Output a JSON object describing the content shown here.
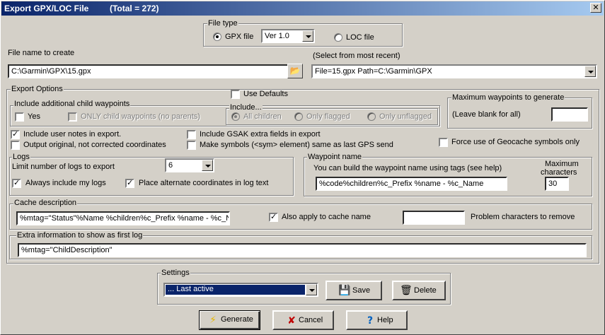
{
  "window": {
    "title": "Export GPX/LOC File",
    "total": "(Total = 272)",
    "close_glyph": "✕"
  },
  "file_type": {
    "label": "File type",
    "gpx_label": "GPX file",
    "gpx_selected": true,
    "version": "Ver 1.0",
    "loc_label": "LOC file",
    "loc_selected": false
  },
  "file_name": {
    "label": "File name to create",
    "value": "C:\\Garmin\\GPX\\15.gpx",
    "recent_label": "(Select from most recent)",
    "recent_value": "File=15.gpx Path=C:\\Garmin\\GPX"
  },
  "export_options": {
    "label": "Export Options",
    "use_defaults": "Use Defaults",
    "child_waypoints": {
      "label": "Include additional child waypoints",
      "yes": "Yes",
      "only_child": "ONLY child waypoints (no parents)",
      "include_label": "Include...",
      "all_children": "All children",
      "only_flagged": "Only flagged",
      "only_unflagged": "Only unflagged"
    },
    "max_waypoints": {
      "label": "Maximum waypoints to generate",
      "hint": "(Leave blank for all)",
      "value": ""
    },
    "include_user_notes": "Include user notes in export.",
    "output_original": "Output original, not corrected coordinates",
    "include_gsak_extra": "Include GSAK extra fields in export",
    "make_symbols": "Make symbols (<sym> element) same as last GPS send",
    "force_geocache_symbols": "Force use of Geocache symbols only",
    "logs": {
      "label": "Logs",
      "limit_label": "Limit number of logs to export",
      "limit_value": "6",
      "always_include_my": "Always include my logs",
      "place_alternate": "Place alternate coordinates in log text"
    },
    "waypoint_name": {
      "label": "Waypoint name",
      "hint": "You can build the waypoint name using tags (see help)",
      "value": "%code%children%c_Prefix %name - %c_Name",
      "max_label_1": "Maximum",
      "max_label_2": "characters",
      "max_value": "30"
    },
    "cache_description": {
      "label": "Cache description",
      "value": "%mtag=\"Status\"%Name %children%c_Prefix %name - %c_Nam",
      "also_apply": "Also apply to cache name",
      "problem_chars_value": "",
      "problem_chars_label": "Problem characters to remove"
    },
    "extra_info": {
      "label": "Extra information to show as first log",
      "value": "%mtag=\"ChildDescription\""
    }
  },
  "settings": {
    "label": "Settings",
    "selected": "... Last active",
    "save": "Save",
    "delete": "Delete"
  },
  "buttons": {
    "generate": "Generate",
    "cancel": "Cancel",
    "help": "Help"
  },
  "icons": {
    "folder": "📂",
    "save": "💾",
    "delete": "🗑",
    "generate": "⚡",
    "cancel": "✘",
    "help": "?"
  },
  "colors": {
    "title_start": "#0a246a",
    "title_end": "#a6caf0",
    "face": "#d4d0c8",
    "selection": "#0a246a"
  }
}
